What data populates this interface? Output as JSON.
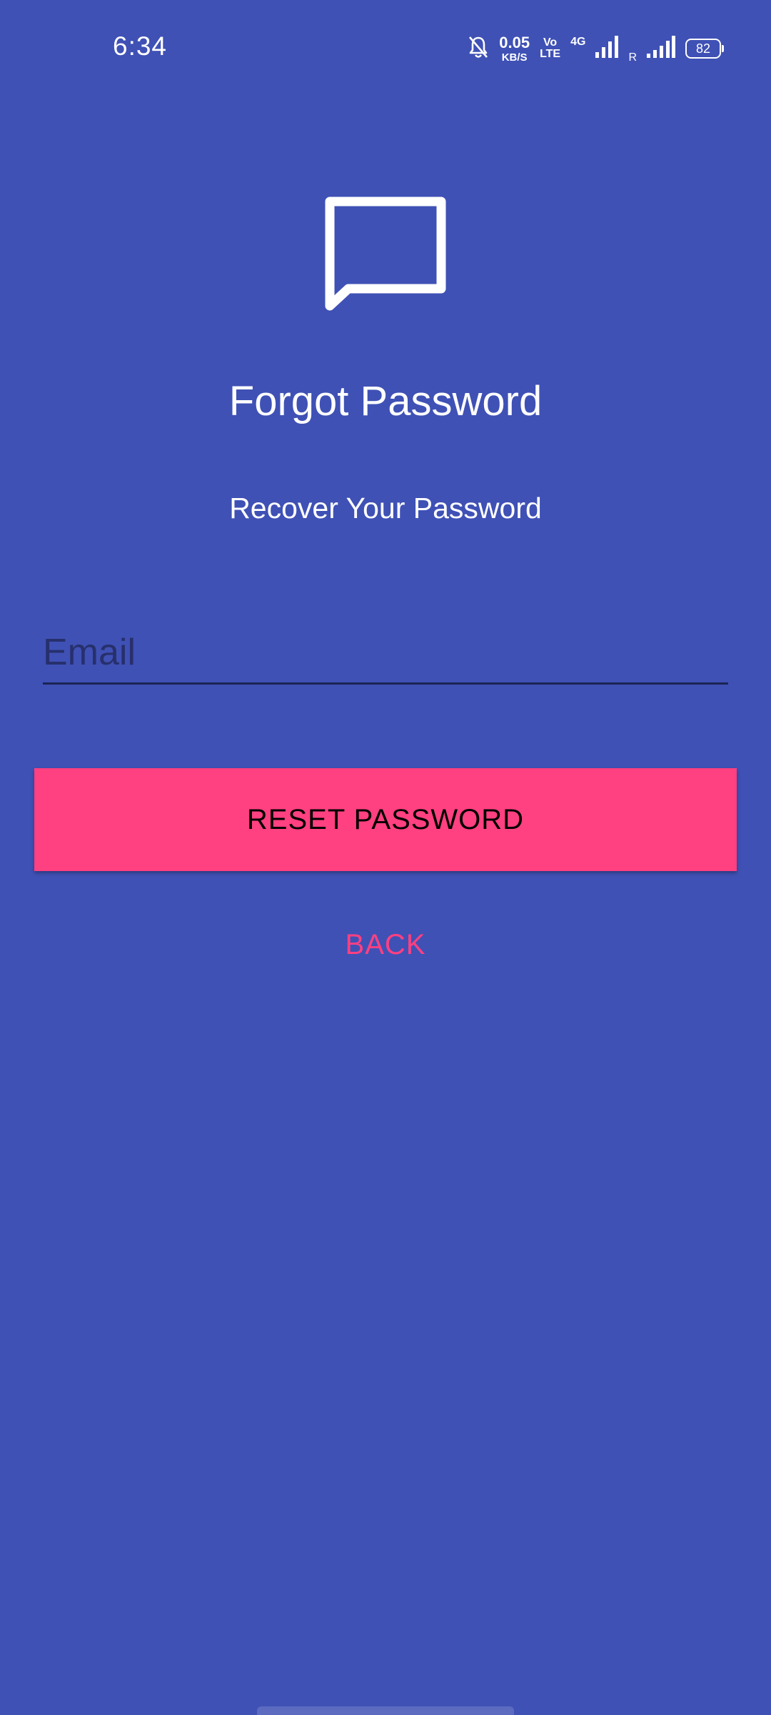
{
  "status_bar": {
    "time": "6:34",
    "speed_value": "0.05",
    "speed_unit": "KB/S",
    "volte_top": "Vo",
    "volte_bottom": "LTE",
    "network_type": "4G",
    "roaming": "R",
    "battery": "82"
  },
  "screen": {
    "title": "Forgot Password",
    "subtitle": "Recover Your Password"
  },
  "form": {
    "email_placeholder": "Email",
    "email_value": "",
    "reset_label": "RESET PASSWORD",
    "back_label": "BACK"
  },
  "colors": {
    "background": "#3F51B5",
    "accent": "#FF4081",
    "text_primary": "#FFFFFF",
    "input_underline": "#1B2454"
  },
  "icons": {
    "logo": "chat-bubble-icon",
    "status": [
      "bell-off-icon",
      "signal-4g-icon",
      "signal-roaming-icon",
      "battery-icon"
    ]
  }
}
